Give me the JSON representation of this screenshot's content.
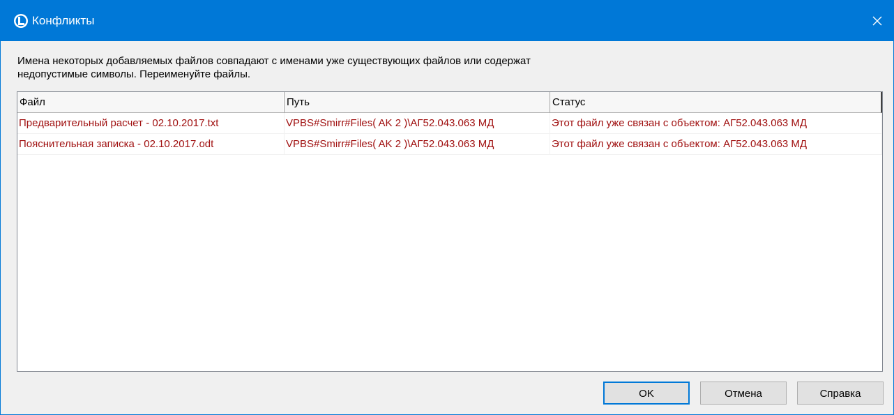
{
  "window": {
    "title": "Конфликты"
  },
  "message": {
    "line1": "Имена некоторых добавляемых файлов совпадают с именами уже существующих файлов или содержат",
    "line2": "недопустимые символы. Переименуйте файлы."
  },
  "table": {
    "columns": [
      "Файл",
      "Путь",
      "Статус"
    ],
    "rows": [
      {
        "file": "Предварительный расчет - 02.10.2017.txt",
        "path": "VPBS#Smirr#Files(  AK 2 )\\АГ52.043.063 МД",
        "status": "Этот файл уже связан с объектом: АГ52.043.063 МД"
      },
      {
        "file": "Пояснительная записка - 02.10.2017.odt",
        "path": "VPBS#Smirr#Files(  AK 2 )\\АГ52.043.063 МД",
        "status": "Этот файл уже связан с объектом: АГ52.043.063 МД"
      }
    ]
  },
  "buttons": {
    "ok": "OK",
    "cancel": "Отмена",
    "help": "Справка"
  },
  "colors": {
    "titlebar": "#0078d7",
    "row_text": "#a01010"
  },
  "icons": {
    "app": "app-logo-icon",
    "close": "close-icon"
  }
}
